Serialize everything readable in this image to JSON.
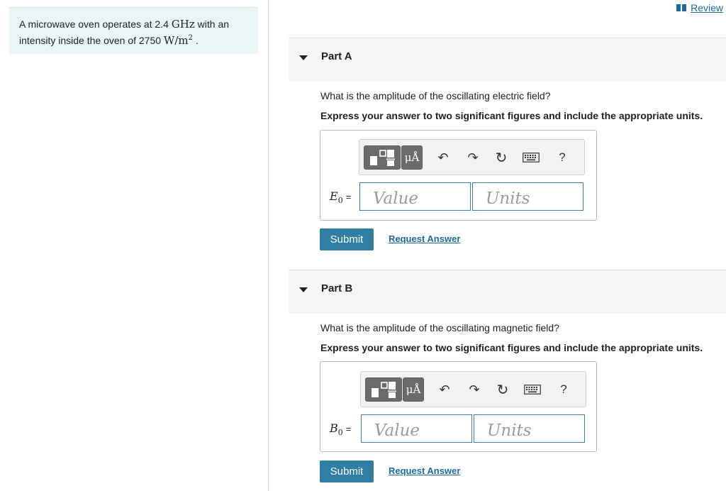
{
  "problem": {
    "text_before": "A microwave oven operates at 2.4 ",
    "freq_unit": "GHz",
    "text_mid": " with an intensity inside the oven of 2750 ",
    "intensity_unit_base": "W/m",
    "intensity_unit_exp": "2",
    "text_end": " ."
  },
  "header": {
    "review_label": "Review"
  },
  "parts": [
    {
      "title": "Part A",
      "question": "What is the amplitude of the oscillating electric field?",
      "instruction": "Express your answer to two significant figures and include the appropriate units.",
      "symbol": "E",
      "subscript": "0",
      "equals": "=",
      "value_placeholder": "Value",
      "units_placeholder": "Units",
      "submit_label": "Submit",
      "request_label": "Request Answer"
    },
    {
      "title": "Part B",
      "question": "What is the amplitude of the oscillating magnetic field?",
      "instruction": "Express your answer to two significant figures and include the appropriate units.",
      "symbol": "B",
      "subscript": "0",
      "equals": "=",
      "value_placeholder": "Value",
      "units_placeholder": "Units",
      "submit_label": "Submit",
      "request_label": "Request Answer"
    }
  ],
  "toolbar": {
    "mu_label": "μÅ",
    "undo_glyph": "↶",
    "redo_glyph": "↷",
    "reset_glyph": "↻",
    "help_label": "?",
    "icons": [
      "templates-icon",
      "units-icon",
      "undo-icon",
      "redo-icon",
      "reset-icon",
      "keyboard-icon",
      "help-icon"
    ]
  },
  "colors": {
    "accent": "#2f7ea3",
    "link": "#1a6b9e",
    "field_border": "#3a7ab8",
    "problem_bg": "#e9f6f5"
  }
}
